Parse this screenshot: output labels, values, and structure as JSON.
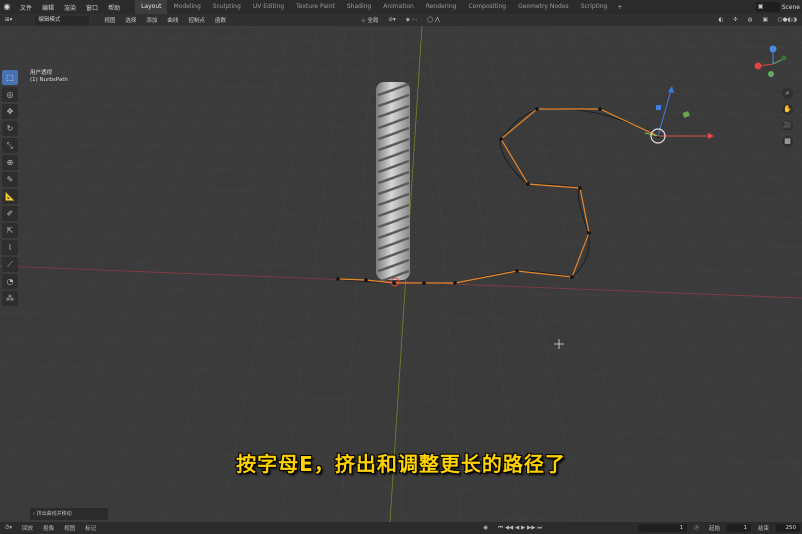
{
  "topbar": {
    "menus": [
      "文件",
      "编辑",
      "渲染",
      "窗口",
      "帮助"
    ],
    "workspaces": [
      "Layout",
      "Modeling",
      "Sculpting",
      "UV Editing",
      "Texture Paint",
      "Shading",
      "Animation",
      "Rendering",
      "Compositing",
      "Geometry Nodes",
      "Scripting"
    ],
    "active_workspace": "Layout",
    "scene_label": "Scene"
  },
  "header": {
    "mode": "编辑模式",
    "items": [
      "视图",
      "选择",
      "添加",
      "曲线",
      "控制点",
      "函数"
    ],
    "orientation": "全局"
  },
  "viewport": {
    "view_name": "用户透视",
    "object_name": "(1) NurbsPath"
  },
  "subtitle": "按字母E，挤出和调整更长的路径了",
  "last_operator": "挤出曲线并移动",
  "timeline": {
    "items": [
      "回放",
      "抠像",
      "视图",
      "标记"
    ],
    "current_frame": "1",
    "start_label": "起始",
    "start_value": "1",
    "end_label": "结束",
    "end_value": "250"
  },
  "colors": {
    "accent": "#4772b3",
    "subtitle": "#ffd200",
    "curve": "#e8872c"
  }
}
